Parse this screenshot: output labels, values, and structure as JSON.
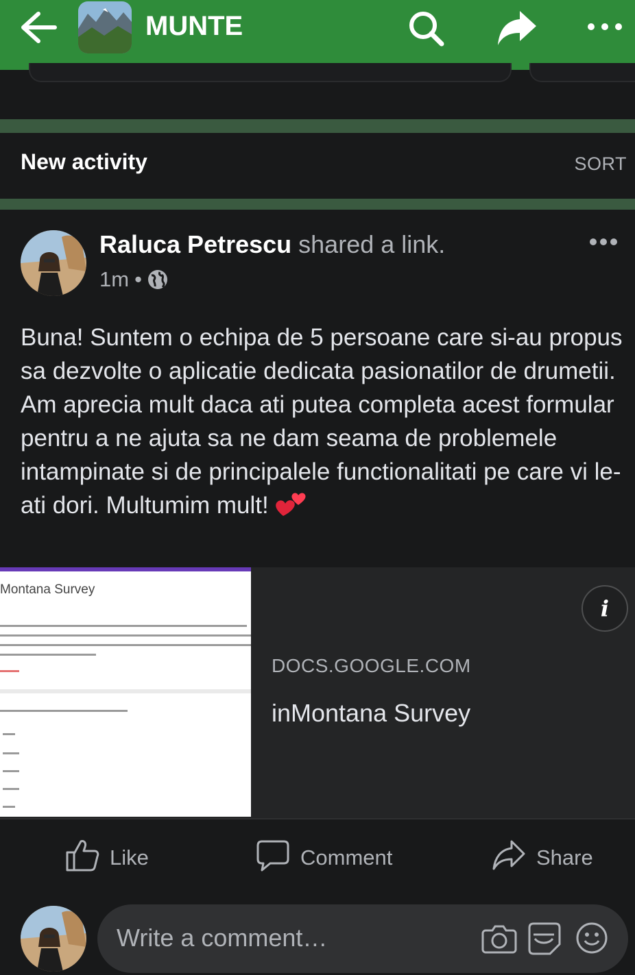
{
  "header": {
    "group_name": "MUNTE",
    "accent_color": "#2f8c3a",
    "icons": [
      "back-arrow-icon",
      "search-icon",
      "share-arrow-icon",
      "more-dots-icon"
    ]
  },
  "activity": {
    "title": "New activity",
    "sort_label": "SORT"
  },
  "post": {
    "author": "Raluca Petrescu",
    "action": " shared a link.",
    "time": "1m",
    "separator": "•",
    "privacy_icon": "globe-icon",
    "text": "Buna! Suntem o echipa de 5 persoane care si-au propus sa dezvolte o aplicatie dedicata pasionatilor de drumetii. Am aprecia mult daca ati putea completa acest formular pentru a ne ajuta sa ne dam seama de problemele intampinate si de principalele functionalitati pe care vi le-ati dori. Multumim mult! ",
    "emoji": "two-hearts-icon"
  },
  "link_card": {
    "thumbnail_title": "Montana Survey",
    "domain": "DOCS.GOOGLE.COM",
    "title": "inMontana Survey",
    "info_label": "i"
  },
  "actions": {
    "like": "Like",
    "comment": "Comment",
    "share": "Share"
  },
  "composer": {
    "placeholder": "Write a comment…",
    "icons": [
      "camera-icon",
      "gif-sticker-icon",
      "emoji-icon"
    ]
  }
}
